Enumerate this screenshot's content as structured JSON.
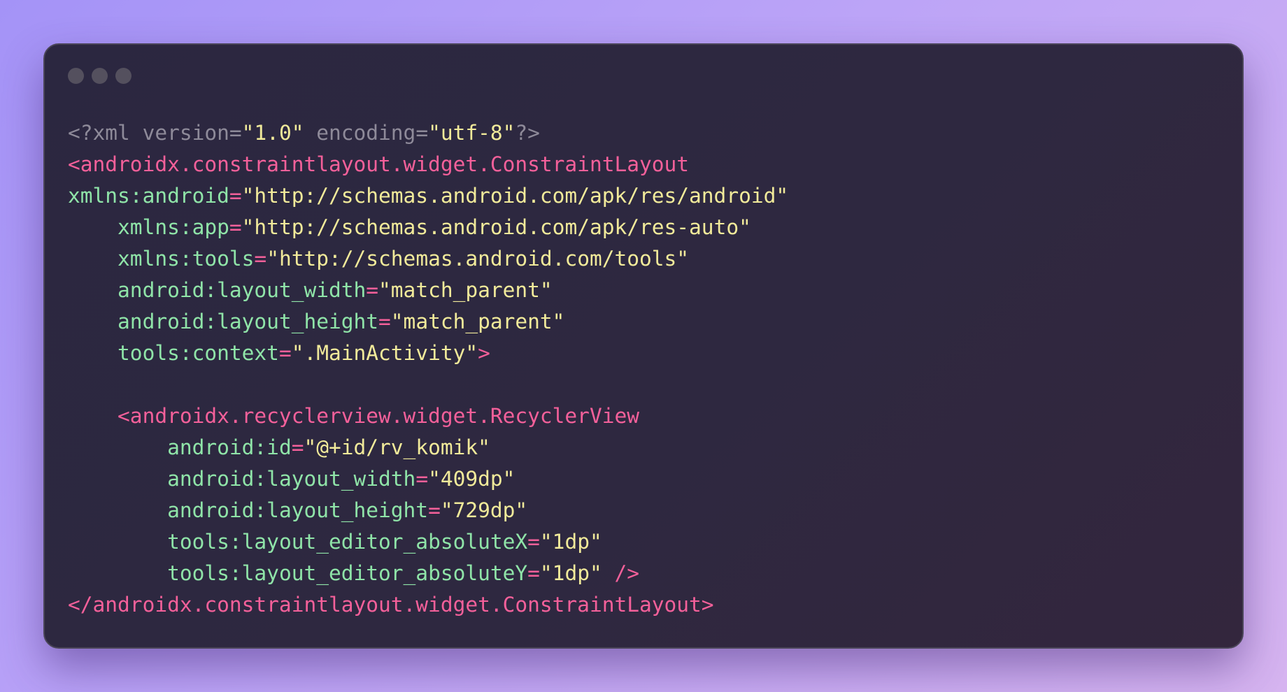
{
  "window": {
    "controls": [
      "window-dot-icon",
      "window-dot-icon",
      "window-dot-icon"
    ]
  },
  "colors": {
    "comment": "#8e8a99",
    "tag": "#f4609a",
    "attribute": "#8fe4a8",
    "value": "#f1ea9a"
  },
  "code_lines": [
    {
      "indent": 0,
      "tokens": [
        {
          "t": "<?xml version=",
          "c": "gray"
        },
        {
          "t": "\"1.0\"",
          "c": "yellow"
        },
        {
          "t": " encoding=",
          "c": "gray"
        },
        {
          "t": "\"utf-8\"",
          "c": "yellow"
        },
        {
          "t": "?>",
          "c": "gray"
        }
      ]
    },
    {
      "indent": 0,
      "tokens": [
        {
          "t": "<androidx.constraintlayout.widget.ConstraintLayout",
          "c": "pink"
        }
      ]
    },
    {
      "indent": 0,
      "tokens": [
        {
          "t": "xmlns:android",
          "c": "green"
        },
        {
          "t": "=",
          "c": "pink"
        },
        {
          "t": "\"http://schemas.android.com/apk/res/android\"",
          "c": "yellow"
        }
      ]
    },
    {
      "indent": 4,
      "tokens": [
        {
          "t": "xmlns:app",
          "c": "green"
        },
        {
          "t": "=",
          "c": "pink"
        },
        {
          "t": "\"http://schemas.android.com/apk/res-auto\"",
          "c": "yellow"
        }
      ]
    },
    {
      "indent": 4,
      "tokens": [
        {
          "t": "xmlns:tools",
          "c": "green"
        },
        {
          "t": "=",
          "c": "pink"
        },
        {
          "t": "\"http://schemas.android.com/tools\"",
          "c": "yellow"
        }
      ]
    },
    {
      "indent": 4,
      "tokens": [
        {
          "t": "android:layout_width",
          "c": "green"
        },
        {
          "t": "=",
          "c": "pink"
        },
        {
          "t": "\"match_parent\"",
          "c": "yellow"
        }
      ]
    },
    {
      "indent": 4,
      "tokens": [
        {
          "t": "android:layout_height",
          "c": "green"
        },
        {
          "t": "=",
          "c": "pink"
        },
        {
          "t": "\"match_parent\"",
          "c": "yellow"
        }
      ]
    },
    {
      "indent": 4,
      "tokens": [
        {
          "t": "tools:context",
          "c": "green"
        },
        {
          "t": "=",
          "c": "pink"
        },
        {
          "t": "\".MainActivity\"",
          "c": "yellow"
        },
        {
          "t": ">",
          "c": "pink"
        }
      ]
    },
    {
      "indent": 0,
      "tokens": []
    },
    {
      "indent": 4,
      "tokens": [
        {
          "t": "<androidx.recyclerview.widget.RecyclerView",
          "c": "pink"
        }
      ]
    },
    {
      "indent": 8,
      "tokens": [
        {
          "t": "android:id",
          "c": "green"
        },
        {
          "t": "=",
          "c": "pink"
        },
        {
          "t": "\"@+id/rv_komik\"",
          "c": "yellow"
        }
      ]
    },
    {
      "indent": 8,
      "tokens": [
        {
          "t": "android:layout_width",
          "c": "green"
        },
        {
          "t": "=",
          "c": "pink"
        },
        {
          "t": "\"409dp\"",
          "c": "yellow"
        }
      ]
    },
    {
      "indent": 8,
      "tokens": [
        {
          "t": "android:layout_height",
          "c": "green"
        },
        {
          "t": "=",
          "c": "pink"
        },
        {
          "t": "\"729dp\"",
          "c": "yellow"
        }
      ]
    },
    {
      "indent": 8,
      "tokens": [
        {
          "t": "tools:layout_editor_absoluteX",
          "c": "green"
        },
        {
          "t": "=",
          "c": "pink"
        },
        {
          "t": "\"1dp\"",
          "c": "yellow"
        }
      ]
    },
    {
      "indent": 8,
      "tokens": [
        {
          "t": "tools:layout_editor_absoluteY",
          "c": "green"
        },
        {
          "t": "=",
          "c": "pink"
        },
        {
          "t": "\"1dp\"",
          "c": "yellow"
        },
        {
          "t": " />",
          "c": "pink"
        }
      ]
    },
    {
      "indent": 0,
      "tokens": [
        {
          "t": "</androidx.constraintlayout.widget.ConstraintLayout>",
          "c": "pink"
        }
      ]
    }
  ]
}
